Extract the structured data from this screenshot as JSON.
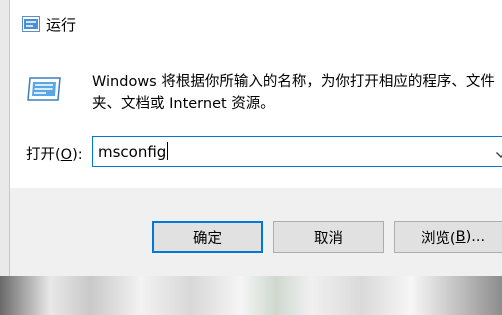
{
  "window": {
    "title": "运行",
    "icon": "run-icon"
  },
  "description": "Windows 将根据你所输入的名称，为你打开相应的程序、文件夹、文档或 Internet 资源。",
  "open_field": {
    "label_prefix": "打开(",
    "label_mnemonic": "O",
    "label_suffix": "):",
    "value": "msconfig",
    "dropdown_icon": "chevron-down-icon"
  },
  "buttons": {
    "ok": "确定",
    "cancel": "取消",
    "browse_prefix": "浏览(",
    "browse_mnemonic": "B",
    "browse_suffix": ")..."
  },
  "colors": {
    "accent": "#0078d7",
    "footer_bg": "#f0f0f0",
    "button_bg": "#e1e1e1"
  }
}
